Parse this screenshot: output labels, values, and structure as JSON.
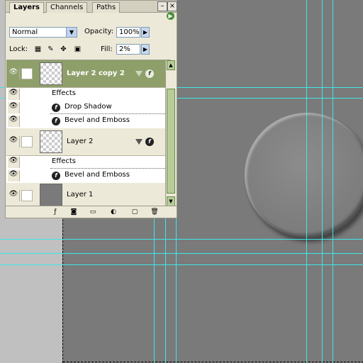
{
  "tabs": [
    "Layers",
    "Channels",
    "Paths"
  ],
  "blend_mode": "Normal",
  "opacity_label": "Opacity:",
  "opacity_value": "100%",
  "lock_label": "Lock:",
  "fill_label": "Fill:",
  "fill_value": "2%",
  "layers": [
    {
      "name": "Layer 2 copy 2"
    },
    {
      "name": "Layer 2"
    },
    {
      "name": "Layer 1"
    }
  ],
  "effects_label": "Effects",
  "effect_drop_shadow": "Drop Shadow",
  "effect_bevel_1": "Bevel and Emboss",
  "effect_bevel_2": "Bevel and Emboss",
  "icons": [
    "eye-icon",
    "brush-icon",
    "fx-icon",
    "chain-icon",
    "lock-icon",
    "trash-icon",
    "new-layer-icon",
    "folder-icon",
    "mask-icon",
    "adjustment-icon"
  ]
}
